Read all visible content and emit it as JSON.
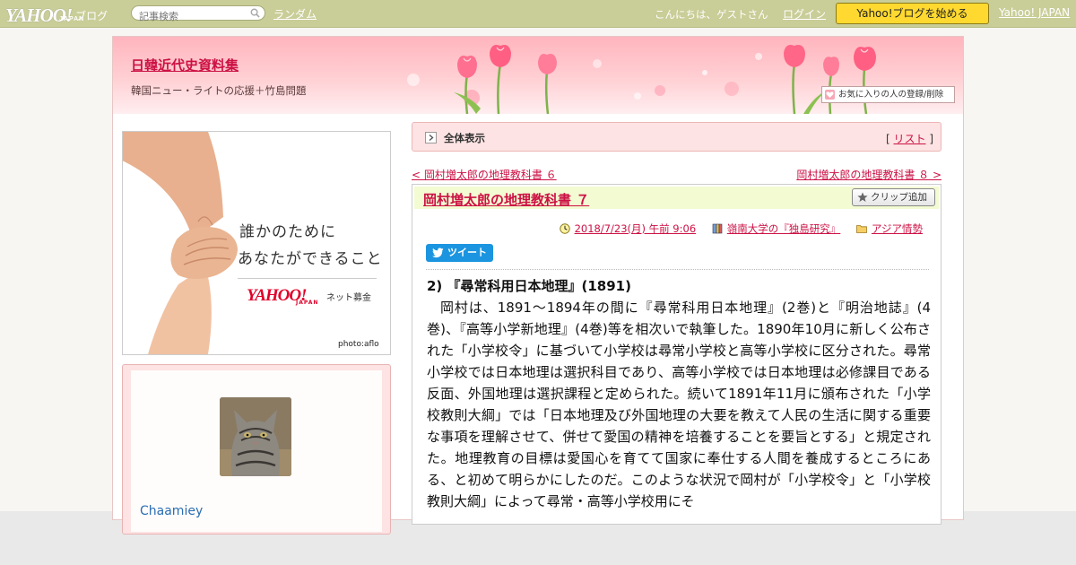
{
  "topbar": {
    "logo_text": "YAHOO!",
    "logo_sub": "JAPAN",
    "logo_blog": "ブログ",
    "search_placeholder": "記事検索",
    "random_label": "ランダム",
    "greeting": "こんにちは、ゲストさん",
    "login_label": "ログイン",
    "start_blog_label": "Yahoo!ブログを始める",
    "yahoo_japan_label": "Yahoo! JAPAN"
  },
  "header": {
    "blog_title": "日韓近代史資料集",
    "subtitle": "韓国ニュー・ライトの応援＋竹島問題",
    "favorite_label": "お気に入りの人の登録/削除"
  },
  "ad": {
    "line1": "誰かのために",
    "line2": "あなたができること",
    "brand": "YAHOO!",
    "brand_sub": "JAPAN",
    "service": "ネット募金",
    "credit": "photo:aflo"
  },
  "profile": {
    "name": "Chaamiey"
  },
  "view_bar": {
    "label": "全体表示",
    "list_open": "[",
    "list_label": "リスト",
    "list_close": "]"
  },
  "nav": {
    "prev_label": "< 岡村増太郎の地理教科書 ６",
    "next_label": "岡村増太郎の地理教科書 ８ >"
  },
  "article": {
    "title": "岡村増太郎の地理教科書 ７",
    "clip_label": "クリップ追加",
    "date": "2018/7/23(月) 午前 9:06",
    "book_category": "嶺南大学の『独島研究』",
    "folder_category": "アジア情勢",
    "tweet_label": "ツイート",
    "section_heading": "2) 『尋常科用日本地理』(1891)",
    "body": "岡村は、1891～1894年の間に『尋常科用日本地理』(2巻)と『明治地誌』(4巻)、『高等小学新地理』(4巻)等を相次いで執筆した。1890年10月に新しく公布された「小学校令」に基づいて小学校は尋常小学校と高等小学校に区分された。尋常小学校では日本地理は選択科目であり、高等小学校では日本地理は必修課目である反面、外国地理は選択課程と定められた。続いて1891年11月に頒布された「小学校教則大綱」では「日本地理及び外国地理の大要を教えて人民の生活に関する重要な事項を理解させて、併せて愛国の精神を培養することを要旨とする」と規定された。地理教育の目標は愛国心を育てて国家に奉仕する人間を養成するところにある、と初めて明らかにしたのだ。このような状況で岡村が「小学校令」と「小学校教則大綱」によって尋常・高等小学校用にそ"
  },
  "colors": {
    "topbar": "#c9cd97",
    "accent_link": "#cc1144",
    "start_button": "#ffd92f",
    "tweet": "#1b95e0"
  }
}
